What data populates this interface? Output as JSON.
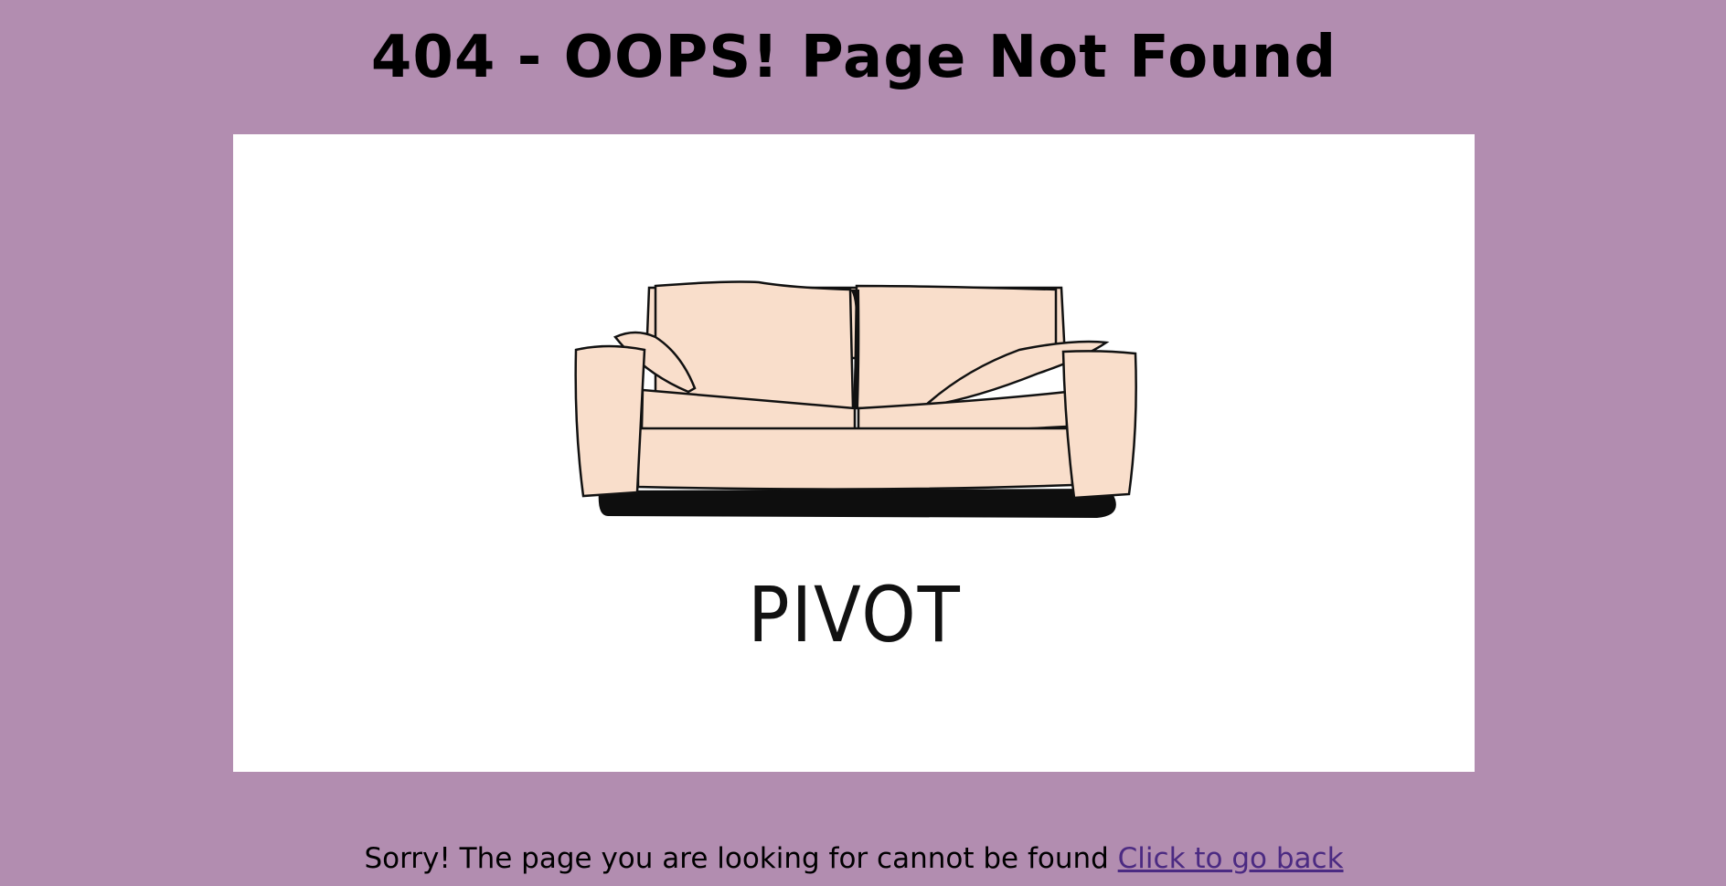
{
  "page": {
    "title": "404 - OOPS! Page Not Found",
    "image_caption": "PIVOT",
    "message": "Sorry! The page you are looking for cannot be found",
    "back_link": "Click to go back"
  },
  "colors": {
    "background": "#b28db0",
    "image_bg": "#ffffff",
    "couch_fill": "#f9decb",
    "link": "#4b2a82"
  },
  "icons": {
    "illustration": "couch-illustration"
  }
}
